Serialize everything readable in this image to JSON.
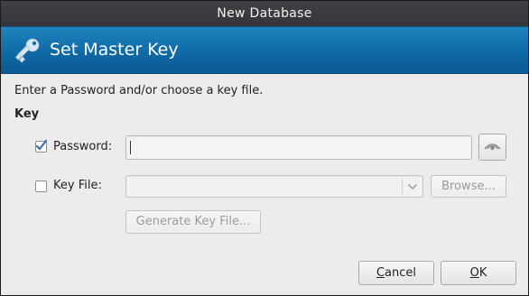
{
  "window": {
    "title": "New Database"
  },
  "banner": {
    "title": "Set Master Key",
    "icon": "key-icon"
  },
  "instruction": "Enter a Password and/or choose a key file.",
  "section_title": "Key",
  "password": {
    "label": "Password:",
    "checked": true,
    "value": "",
    "toggle_icon": "eye-icon"
  },
  "key_file": {
    "label": "Key File:",
    "checked": false,
    "value": "",
    "browse_label": "Browse...",
    "generate_label": "Generate Key File..."
  },
  "buttons": {
    "cancel": {
      "label": "Cancel",
      "mnemonic": "C",
      "rest": "ancel"
    },
    "ok": {
      "label": "OK",
      "mnemonic": "O",
      "rest": "K"
    }
  },
  "colors": {
    "banner": "#0f6aa6",
    "titlebar": "#3a3c40",
    "checkmark": "#3c6db5"
  }
}
